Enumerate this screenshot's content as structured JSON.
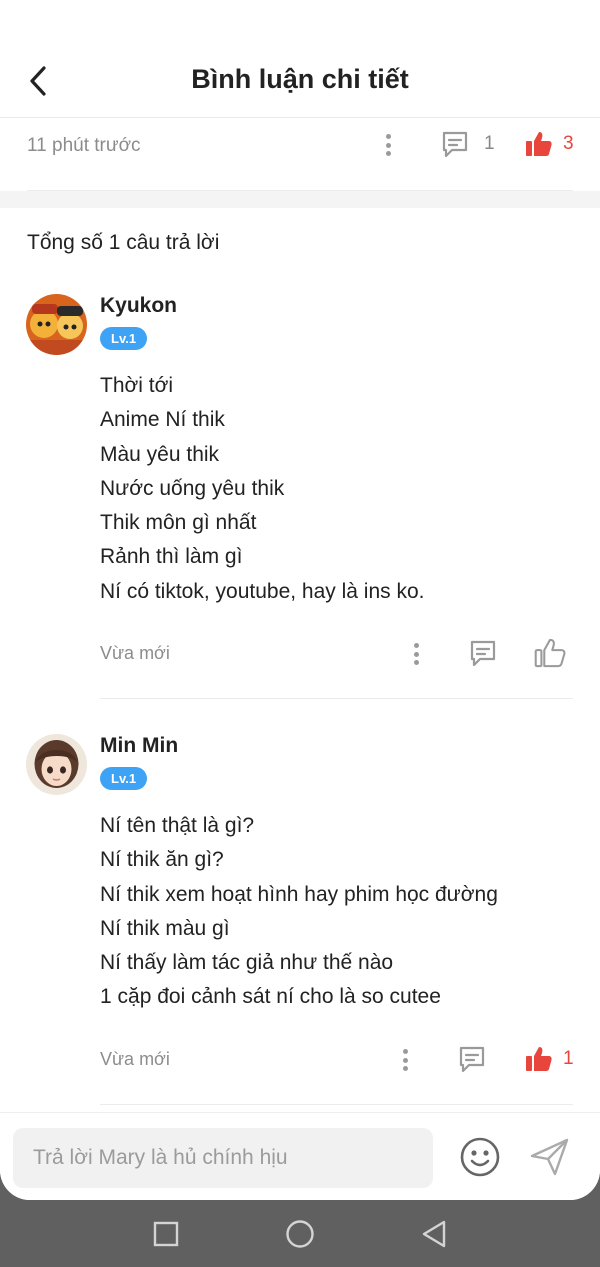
{
  "header": {
    "title": "Bình luận chi tiết"
  },
  "post_meta": {
    "time": "11 phút trước",
    "comment_count": "1",
    "like_count": "3"
  },
  "replies_total": "Tổng số 1 câu trả lời",
  "replies": [
    {
      "username": "Kyukon",
      "level": "Lv.1",
      "lines": [
        "Thời tới",
        "Anime Ní thik",
        "Màu yêu thik",
        "Nước uống yêu thik",
        "Thik môn gì nhất",
        "Rảnh thì làm gì",
        "Ní có tiktok, youtube, hay là ins ko."
      ],
      "time": "Vừa mới",
      "liked": false
    },
    {
      "username": "Min Min",
      "level": "Lv.1",
      "lines": [
        "Ní tên thật là gì?",
        "Ní thik ăn gì?",
        "Ní thik xem hoạt hình hay phim học đường",
        "Ní thik màu gì",
        "Ní thấy làm tác giả như thế nào",
        "1 cặp đoi cảnh sát ní cho là so cutee"
      ],
      "time": "Vừa mới",
      "liked": true,
      "like_count": "1"
    }
  ],
  "reply_input": {
    "placeholder": "Trả lời Mary là hủ chính hịu",
    "value": ""
  },
  "icons": {
    "back": "chevron-left-icon",
    "more": "more-vertical-icon",
    "comment": "comment-icon",
    "like": "thumbs-up-icon",
    "emoji": "emoji-icon",
    "send": "send-icon",
    "nav": [
      "square-icon",
      "circle-icon",
      "triangle-back-icon"
    ]
  },
  "colors": {
    "accent": "#e8453c",
    "level_badge": "#3ea3f5",
    "nav_bar": "#606060"
  }
}
